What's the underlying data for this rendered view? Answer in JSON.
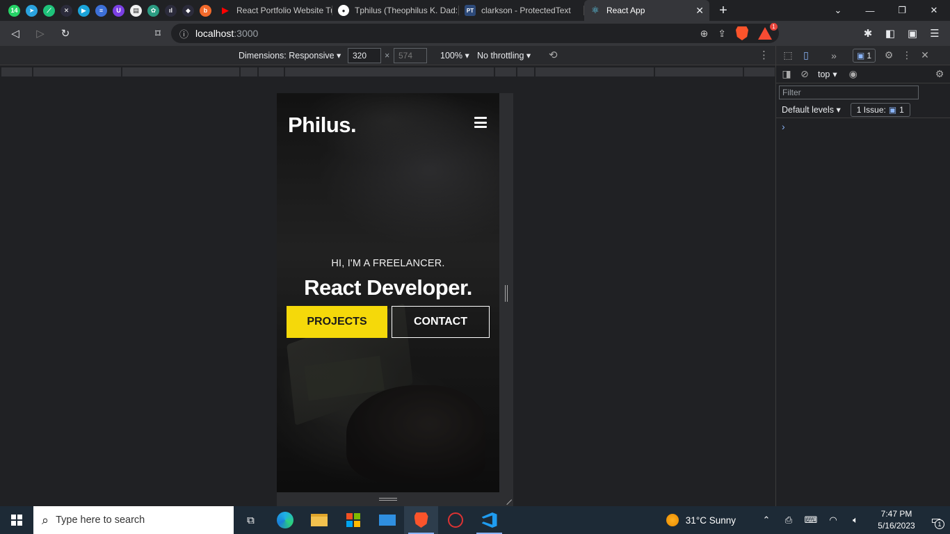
{
  "browser": {
    "pinned_tabs": [
      {
        "icon": "whatsapp-icon",
        "color": "#25d366",
        "glyph": "14"
      },
      {
        "icon": "telegram-icon",
        "color": "#2aa3df",
        "glyph": "➤"
      },
      {
        "icon": "app-icon",
        "color": "#1ec27a",
        "glyph": "⟋"
      },
      {
        "icon": "tools-icon",
        "color": "#2b2b3b",
        "glyph": "✕"
      },
      {
        "icon": "play-icon",
        "color": "#1aa3d9",
        "glyph": "▶"
      },
      {
        "icon": "docs-icon",
        "color": "#3c6fd8",
        "glyph": "≡"
      },
      {
        "icon": "proton-icon",
        "color": "#7b3fe4",
        "glyph": "U"
      },
      {
        "icon": "news-icon",
        "color": "#f0f0f0",
        "glyph": "▤"
      },
      {
        "icon": "chatgpt-icon",
        "color": "#2b9c82",
        "glyph": "✿"
      },
      {
        "icon": "chart-icon",
        "color": "#2b2b3b",
        "glyph": "ıl"
      },
      {
        "icon": "figma-icon",
        "color": "#2b2b3b",
        "glyph": "◆"
      },
      {
        "icon": "b-icon",
        "color": "#f36a2b",
        "glyph": "b"
      }
    ],
    "tabs": [
      {
        "title": "React Portfolio Website Tut",
        "icon": "youtube-icon",
        "color": "#ff0000",
        "glyph": "▶"
      },
      {
        "title": "Tphilus (Theophilus K. Dad:",
        "icon": "github-icon",
        "color": "#ffffff",
        "glyph": "●"
      },
      {
        "title": "clarkson - ProtectedText",
        "icon": "protectedtext-icon",
        "color": "#2d4a7a",
        "glyph": "PT"
      },
      {
        "title": "React App",
        "icon": "react-icon",
        "color": "#61dafb",
        "glyph": "⚛"
      }
    ],
    "url_host": "localhost",
    "url_port": ":3000",
    "rewards_badge": "1"
  },
  "device_toolbar": {
    "dimensions_label": "Dimensions: Responsive",
    "width": "320",
    "height": "574",
    "times": "×",
    "zoom": "100%",
    "throttling": "No throttling"
  },
  "site": {
    "logo": "Philus.",
    "hero_subtitle": "HI, I'M A FREELANCER.",
    "hero_title": "React Developer.",
    "projects_label": "PROJECTS",
    "contact_label": "CONTACT",
    "accent_color": "#f5d90a"
  },
  "devtools": {
    "issues_count": "1",
    "context": "top",
    "filter_placeholder": "Filter",
    "default_levels": "Default levels",
    "issues_label": "1 Issue:",
    "issues_badge": "1",
    "prompt": "›"
  },
  "taskbar": {
    "search_placeholder": "Type here to search",
    "weather": "31°C  Sunny",
    "time": "7:47 PM",
    "date": "5/16/2023",
    "notifications": "1"
  }
}
